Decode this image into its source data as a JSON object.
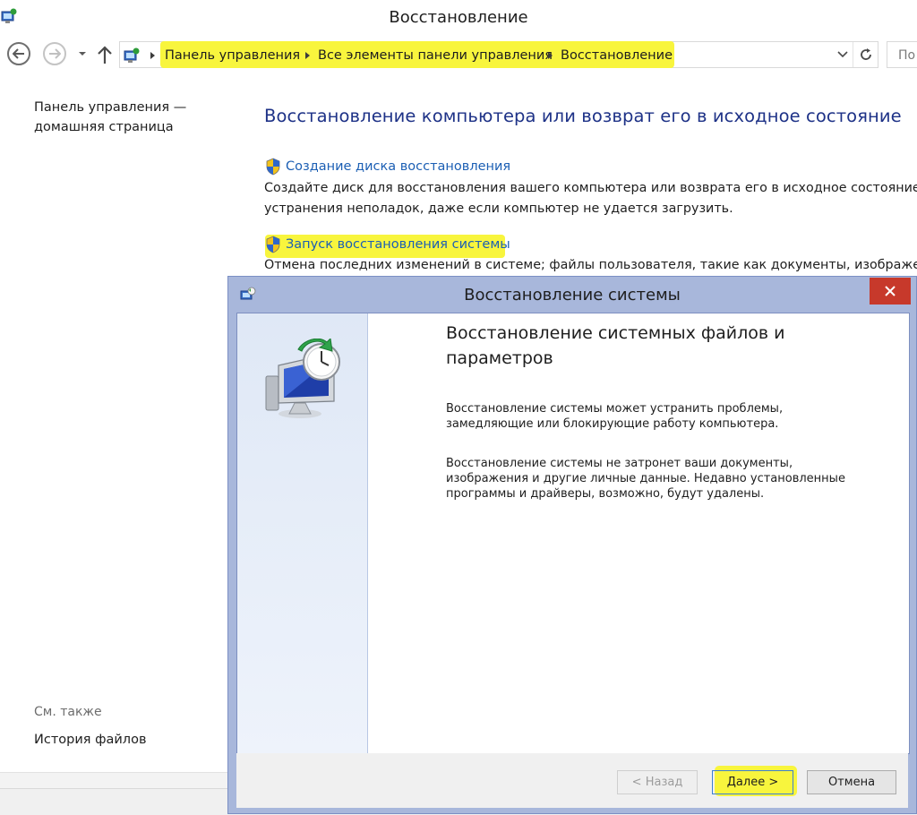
{
  "window": {
    "title": "Восстановление"
  },
  "breadcrumb": {
    "items": [
      "Панель управления",
      "Все элементы панели управления",
      "Восстановление"
    ]
  },
  "search": {
    "placeholder": "По"
  },
  "left_pane": {
    "home_link": "Панель управления — домашняя страница",
    "see_also": "См. также",
    "file_history": "История файлов"
  },
  "main": {
    "heading": "Восстановление компьютера или возврат его в исходное состояние",
    "tasks": [
      {
        "link": "Создание диска восстановления",
        "desc_line1": "Создайте диск для восстановления вашего компьютера или возврата его в исходное состояние либ",
        "desc_line2": "устранения неполадок, даже если компьютер не удается загрузить."
      },
      {
        "link": "Запуск восстановления системы",
        "desc_line1": "Отмена последних изменений в системе; файлы пользователя, такие как документы, изображения и"
      }
    ]
  },
  "dialog": {
    "title": "Восстановление системы",
    "heading": "Восстановление системных файлов и параметров",
    "paragraph1": "Восстановление системы может устранить проблемы, замедляющие или блокирующие работу компьютера.",
    "paragraph2": "Восстановление системы не затронет ваши документы, изображения и другие личные данные. Недавно установленные программы и драйверы, возможно, будут удалены.",
    "buttons": {
      "back": "< Назад",
      "next": "Далее >",
      "cancel": "Отмена"
    }
  },
  "colors": {
    "heading_blue": "#1e3287",
    "link_blue": "#1c5fb4",
    "highlight_yellow": "#f8f53d",
    "dialog_frame": "#a8b7db",
    "close_red": "#c7392b"
  },
  "icons": [
    "control-panel-icon",
    "back-arrow-icon",
    "forward-arrow-icon",
    "up-arrow-icon",
    "refresh-icon",
    "uac-shield-icon",
    "system-restore-icon",
    "close-icon"
  ]
}
